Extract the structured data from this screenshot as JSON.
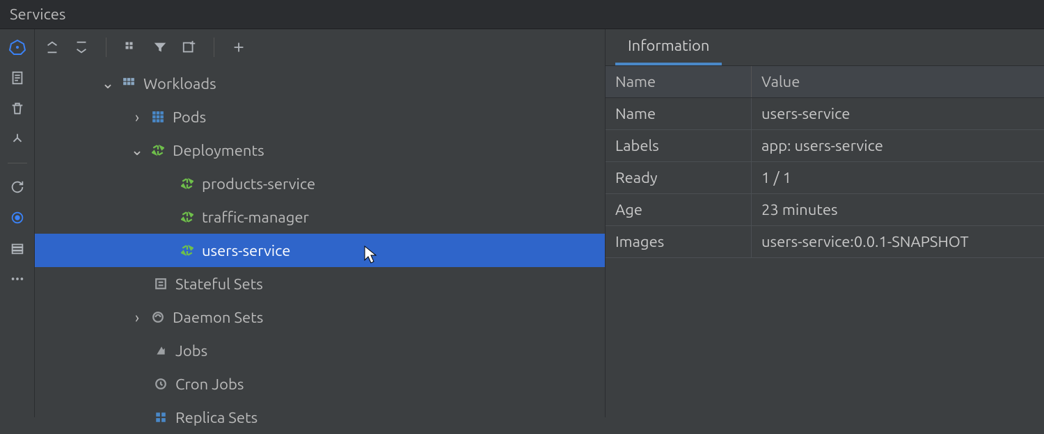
{
  "titlebar": "Services",
  "sidebar_icons": [
    "kubernetes",
    "document",
    "trash",
    "branch",
    "refresh",
    "target",
    "database",
    "more"
  ],
  "toolbar_icons": [
    "collapse-up",
    "collapse-down",
    "grid",
    "filter",
    "tab-add",
    "add"
  ],
  "tree": {
    "workloads": {
      "label": "Workloads",
      "children": {
        "pods": {
          "label": "Pods"
        },
        "deployments": {
          "label": "Deployments",
          "items": [
            {
              "label": "products-service"
            },
            {
              "label": "traffic-manager"
            },
            {
              "label": "users-service",
              "selected": true
            }
          ]
        },
        "stateful": {
          "label": "Stateful Sets"
        },
        "daemon": {
          "label": "Daemon Sets"
        },
        "jobs": {
          "label": "Jobs"
        },
        "cronjobs": {
          "label": "Cron Jobs"
        },
        "replicasets": {
          "label": "Replica Sets"
        }
      }
    }
  },
  "info": {
    "tab": "Information",
    "headers": {
      "name": "Name",
      "value": "Value"
    },
    "rows": [
      {
        "name": "Name",
        "value": "users-service"
      },
      {
        "name": "Labels",
        "value": "app: users-service"
      },
      {
        "name": "Ready",
        "value": "1 / 1"
      },
      {
        "name": "Age",
        "value": "23 minutes"
      },
      {
        "name": "Images",
        "value": "users-service:0.0.1-SNAPSHOT"
      }
    ]
  }
}
